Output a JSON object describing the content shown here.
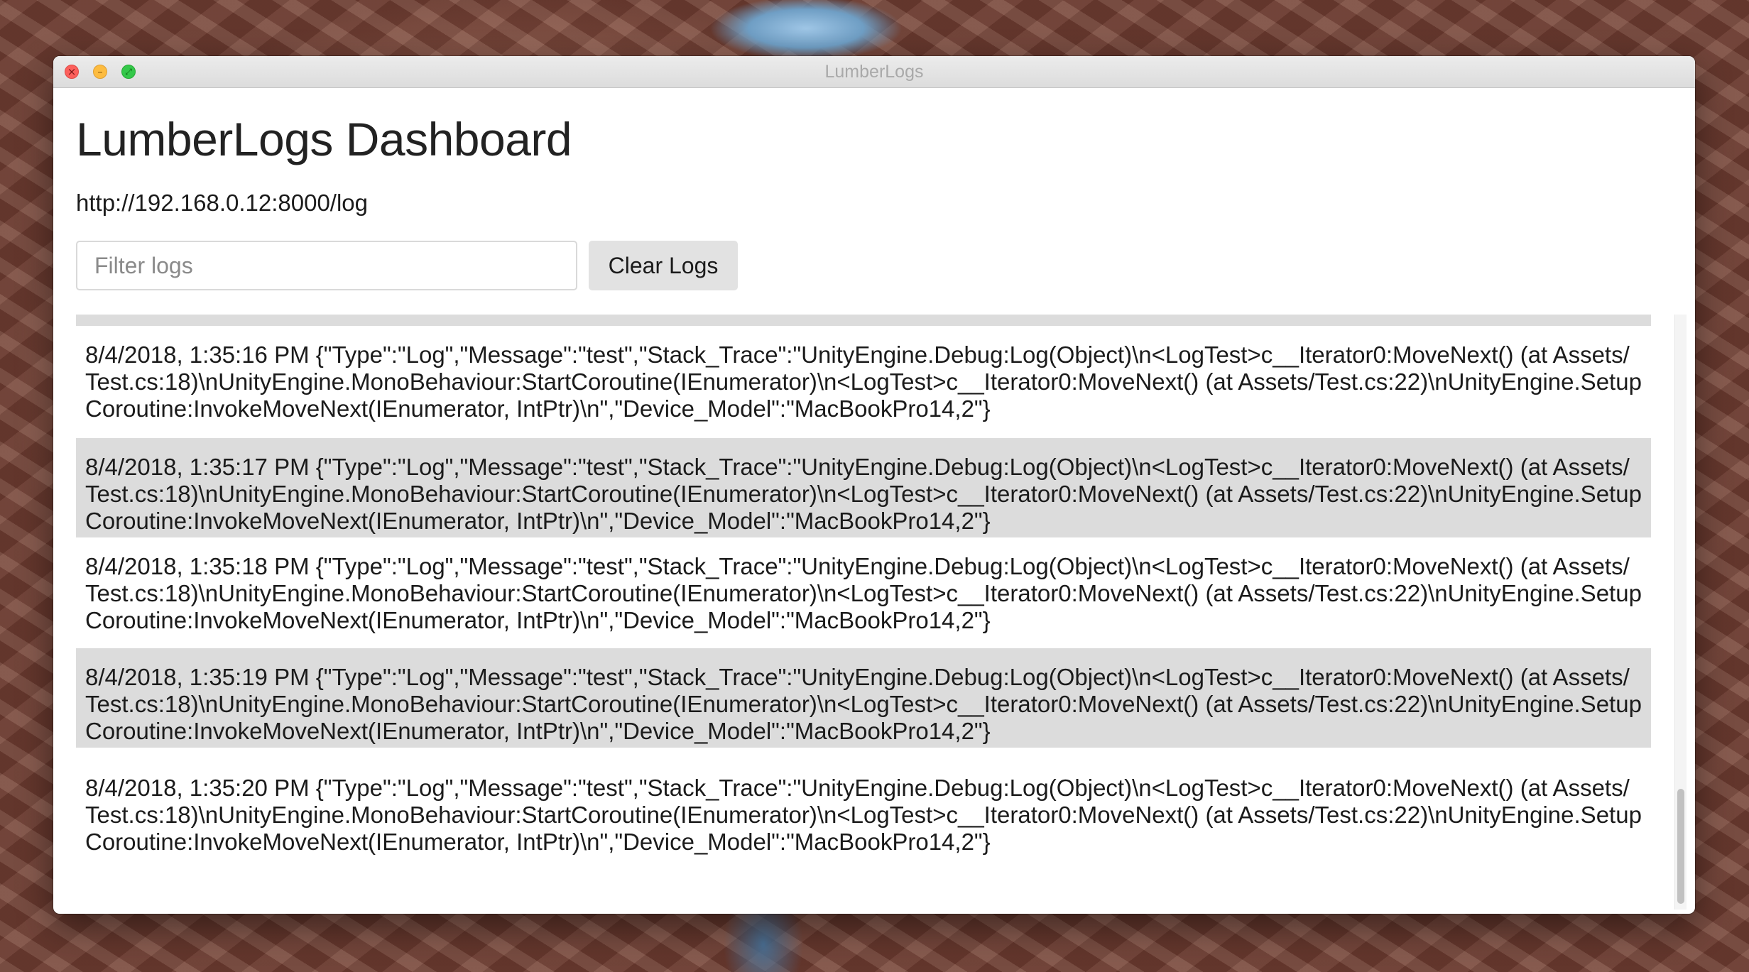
{
  "window": {
    "title": "LumberLogs"
  },
  "header": {
    "title": "LumberLogs Dashboard",
    "endpoint": "http://192.168.0.12:8000/log"
  },
  "toolbar": {
    "filter_placeholder": "Filter logs",
    "filter_value": "",
    "clear_label": "Clear Logs"
  },
  "logs": [
    {
      "text": ""
    },
    {
      "text": "8/4/2018, 1:35:16 PM {\"Type\":\"Log\",\"Message\":\"test\",\"Stack_Trace\":\"UnityEngine.Debug:Log(Object)\\n<LogTest>c__Iterator0:MoveNext() (at Assets/Test.cs:18)\\nUnityEngine.MonoBehaviour:StartCoroutine(IEnumerator)\\n<LogTest>c__Iterator0:MoveNext() (at Assets/Test.cs:22)\\nUnityEngine.SetupCoroutine:InvokeMoveNext(IEnumerator, IntPtr)\\n\",\"Device_Model\":\"MacBookPro14,2\"}"
    },
    {
      "text": "8/4/2018, 1:35:17 PM {\"Type\":\"Log\",\"Message\":\"test\",\"Stack_Trace\":\"UnityEngine.Debug:Log(Object)\\n<LogTest>c__Iterator0:MoveNext() (at Assets/Test.cs:18)\\nUnityEngine.MonoBehaviour:StartCoroutine(IEnumerator)\\n<LogTest>c__Iterator0:MoveNext() (at Assets/Test.cs:22)\\nUnityEngine.SetupCoroutine:InvokeMoveNext(IEnumerator, IntPtr)\\n\",\"Device_Model\":\"MacBookPro14,2\"}"
    },
    {
      "text": "8/4/2018, 1:35:18 PM {\"Type\":\"Log\",\"Message\":\"test\",\"Stack_Trace\":\"UnityEngine.Debug:Log(Object)\\n<LogTest>c__Iterator0:MoveNext() (at Assets/Test.cs:18)\\nUnityEngine.MonoBehaviour:StartCoroutine(IEnumerator)\\n<LogTest>c__Iterator0:MoveNext() (at Assets/Test.cs:22)\\nUnityEngine.SetupCoroutine:InvokeMoveNext(IEnumerator, IntPtr)\\n\",\"Device_Model\":\"MacBookPro14,2\"}"
    },
    {
      "text": "8/4/2018, 1:35:19 PM {\"Type\":\"Log\",\"Message\":\"test\",\"Stack_Trace\":\"UnityEngine.Debug:Log(Object)\\n<LogTest>c__Iterator0:MoveNext() (at Assets/Test.cs:18)\\nUnityEngine.MonoBehaviour:StartCoroutine(IEnumerator)\\n<LogTest>c__Iterator0:MoveNext() (at Assets/Test.cs:22)\\nUnityEngine.SetupCoroutine:InvokeMoveNext(IEnumerator, IntPtr)\\n\",\"Device_Model\":\"MacBookPro14,2\"}"
    },
    {
      "text": "8/4/2018, 1:35:20 PM {\"Type\":\"Log\",\"Message\":\"test\",\"Stack_Trace\":\"UnityEngine.Debug:Log(Object)\\n<LogTest>c__Iterator0:MoveNext() (at Assets/Test.cs:18)\\nUnityEngine.MonoBehaviour:StartCoroutine(IEnumerator)\\n<LogTest>c__Iterator0:MoveNext() (at Assets/Test.cs:22)\\nUnityEngine.SetupCoroutine:InvokeMoveNext(IEnumerator, IntPtr)\\n\",\"Device_Model\":\"MacBookPro14,2\"}"
    }
  ],
  "colors": {
    "shaded_row": "#dcdcdc",
    "window_bg": "#ffffff",
    "close": "#fc605c",
    "minimize": "#fdbc40",
    "maximize": "#34c84a"
  },
  "icons": {
    "close": "close-icon",
    "minimize": "minimize-icon",
    "maximize": "maximize-icon"
  }
}
